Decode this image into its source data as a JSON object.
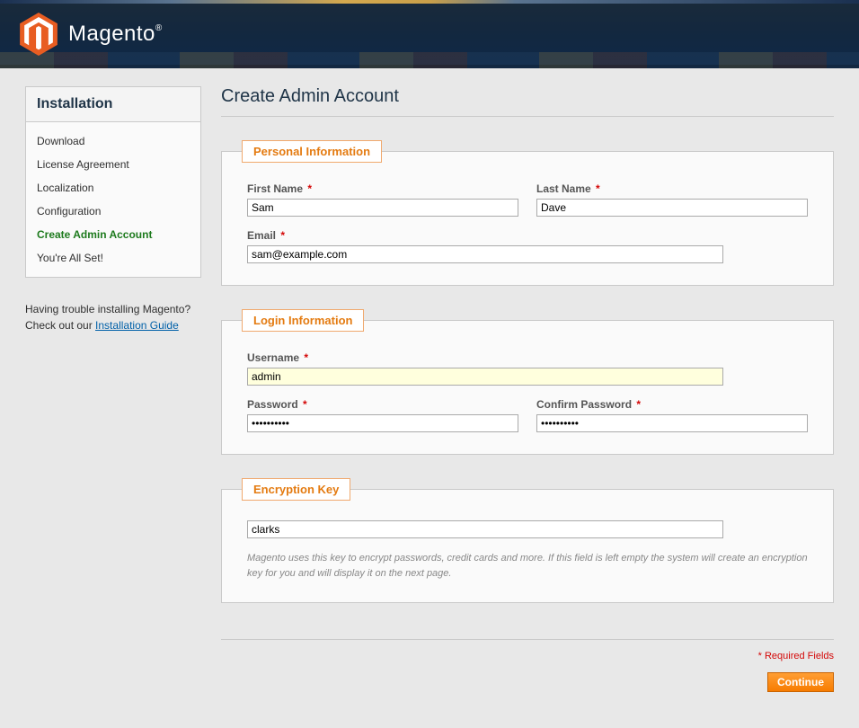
{
  "brand": {
    "name": "Magento",
    "reg": "®"
  },
  "sidebar": {
    "title": "Installation",
    "items": [
      {
        "label": "Download",
        "active": false
      },
      {
        "label": "License Agreement",
        "active": false
      },
      {
        "label": "Localization",
        "active": false
      },
      {
        "label": "Configuration",
        "active": false
      },
      {
        "label": "Create Admin Account",
        "active": true
      },
      {
        "label": "You're All Set!",
        "active": false
      }
    ],
    "help_line1": "Having trouble installing Magento?",
    "help_line2_prefix": "Check out our ",
    "help_link": "Installation Guide"
  },
  "page": {
    "title": "Create Admin Account",
    "required_note": "* Required Fields",
    "continue": "Continue"
  },
  "fieldsets": {
    "personal": {
      "legend": "Personal Information",
      "first_name_label": "First Name",
      "first_name_value": "Sam",
      "last_name_label": "Last Name",
      "last_name_value": "Dave",
      "email_label": "Email",
      "email_value": "sam@example.com"
    },
    "login": {
      "legend": "Login Information",
      "username_label": "Username",
      "username_value": "admin",
      "password_label": "Password",
      "password_value": "••••••••••",
      "confirm_label": "Confirm Password",
      "confirm_value": "••••••••••"
    },
    "encryption": {
      "legend": "Encryption Key",
      "value": "clarks",
      "hint": "Magento uses this key to encrypt passwords, credit cards and more. If this field is left empty the system will create an encryption key for you and will display it on the next page."
    }
  }
}
